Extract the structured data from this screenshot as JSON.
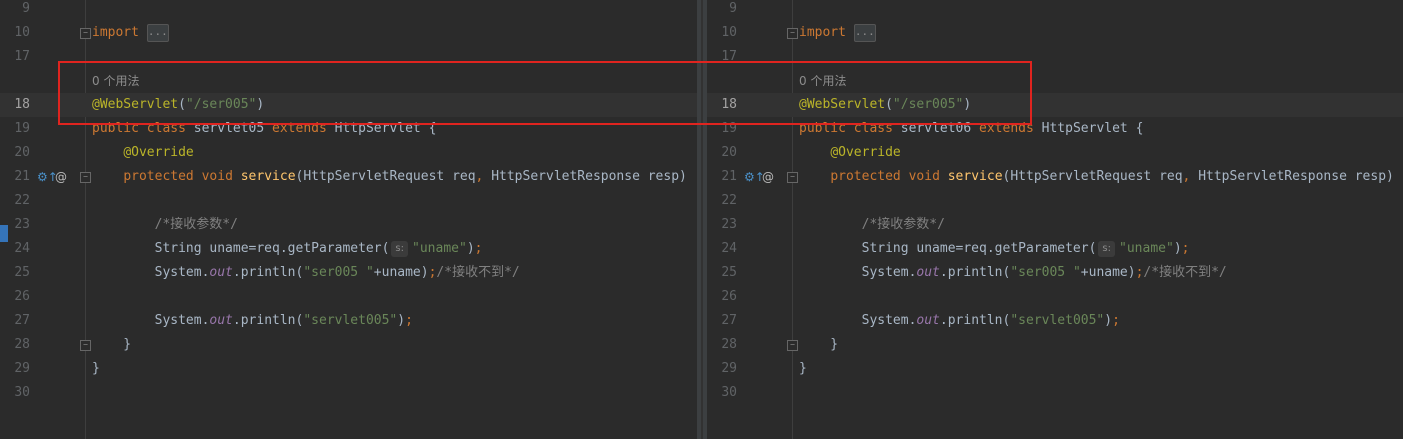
{
  "left_editor": {
    "lines": [
      {
        "num": "9",
        "tokens": []
      },
      {
        "num": "10",
        "fold": true,
        "tokens": [
          {
            "t": "import",
            "c": "kw"
          },
          {
            "t": " "
          },
          {
            "t": "...",
            "c": "foldbox"
          }
        ]
      },
      {
        "num": "17",
        "tokens": []
      },
      {
        "num": "",
        "tokens": [
          {
            "t": "0 个用法",
            "c": "hint"
          }
        ]
      },
      {
        "num": "18",
        "current": true,
        "tokens": [
          {
            "t": "@WebServlet",
            "c": "ann"
          },
          {
            "t": "("
          },
          {
            "t": "\"/ser005\"",
            "c": "str"
          },
          {
            "t": ")"
          }
        ]
      },
      {
        "num": "19",
        "tokens": [
          {
            "t": "public",
            "c": "kw"
          },
          {
            "t": " "
          },
          {
            "t": "class",
            "c": "kw"
          },
          {
            "t": " servlet05 "
          },
          {
            "t": "extends",
            "c": "kw"
          },
          {
            "t": " HttpServlet {"
          }
        ]
      },
      {
        "num": "20",
        "tokens": [
          {
            "t": "    "
          },
          {
            "t": "@Override",
            "c": "ann"
          }
        ]
      },
      {
        "num": "21",
        "gutter_icons": true,
        "tokens": [
          {
            "t": "    "
          },
          {
            "t": "protected",
            "c": "kw"
          },
          {
            "t": " "
          },
          {
            "t": "void",
            "c": "kw"
          },
          {
            "t": " "
          },
          {
            "t": "service",
            "c": "fn"
          },
          {
            "t": "(HttpServletRequest req"
          },
          {
            "t": ",",
            "c": "kw"
          },
          {
            "t": " HttpServletResponse resp)"
          }
        ]
      },
      {
        "num": "22",
        "tokens": []
      },
      {
        "num": "23",
        "tokens": [
          {
            "t": "        "
          },
          {
            "t": "/*接收参数*/",
            "c": "cm"
          }
        ]
      },
      {
        "num": "24",
        "tokens": [
          {
            "t": "        String uname=req.getParameter("
          },
          {
            "t": "s:",
            "c": "paramhint"
          },
          {
            "t": "\"uname\"",
            "c": "str"
          },
          {
            "t": ")"
          },
          {
            "t": ";",
            "c": "kw"
          }
        ]
      },
      {
        "num": "25",
        "tokens": [
          {
            "t": "        System."
          },
          {
            "t": "out",
            "c": "it"
          },
          {
            "t": ".println("
          },
          {
            "t": "\"ser005 \"",
            "c": "str"
          },
          {
            "t": "+uname)"
          },
          {
            "t": ";",
            "c": "kw"
          },
          {
            "t": "/*接收不到*/",
            "c": "cm"
          }
        ]
      },
      {
        "num": "26",
        "tokens": []
      },
      {
        "num": "27",
        "tokens": [
          {
            "t": "        System."
          },
          {
            "t": "out",
            "c": "it"
          },
          {
            "t": ".println("
          },
          {
            "t": "\"servlet005\"",
            "c": "str"
          },
          {
            "t": ")"
          },
          {
            "t": ";",
            "c": "kw"
          }
        ]
      },
      {
        "num": "28",
        "tokens": [
          {
            "t": "    }"
          }
        ]
      },
      {
        "num": "29",
        "tokens": [
          {
            "t": "}"
          }
        ]
      },
      {
        "num": "30",
        "tokens": []
      }
    ]
  },
  "right_editor": {
    "lines": [
      {
        "num": "9",
        "tokens": []
      },
      {
        "num": "10",
        "fold": true,
        "tokens": [
          {
            "t": "import",
            "c": "kw"
          },
          {
            "t": " "
          },
          {
            "t": "...",
            "c": "foldbox"
          }
        ]
      },
      {
        "num": "17",
        "tokens": []
      },
      {
        "num": "",
        "tokens": [
          {
            "t": "0 个用法",
            "c": "hint"
          }
        ]
      },
      {
        "num": "18",
        "current": true,
        "tokens": [
          {
            "t": "@WebServlet",
            "c": "ann"
          },
          {
            "t": "("
          },
          {
            "t": "\"/ser005\"",
            "c": "str"
          },
          {
            "t": ")"
          }
        ]
      },
      {
        "num": "19",
        "tokens": [
          {
            "t": "public",
            "c": "kw"
          },
          {
            "t": " "
          },
          {
            "t": "class",
            "c": "kw"
          },
          {
            "t": " servlet06 "
          },
          {
            "t": "extends",
            "c": "kw"
          },
          {
            "t": " HttpServlet {"
          }
        ]
      },
      {
        "num": "20",
        "tokens": [
          {
            "t": "    "
          },
          {
            "t": "@Override",
            "c": "ann"
          }
        ]
      },
      {
        "num": "21",
        "gutter_icons": true,
        "tokens": [
          {
            "t": "    "
          },
          {
            "t": "protected",
            "c": "kw"
          },
          {
            "t": " "
          },
          {
            "t": "void",
            "c": "kw"
          },
          {
            "t": " "
          },
          {
            "t": "service",
            "c": "fn"
          },
          {
            "t": "(HttpServletRequest req"
          },
          {
            "t": ",",
            "c": "kw"
          },
          {
            "t": " HttpServletResponse resp)"
          }
        ]
      },
      {
        "num": "22",
        "tokens": []
      },
      {
        "num": "23",
        "tokens": [
          {
            "t": "        "
          },
          {
            "t": "/*接收参数*/",
            "c": "cm"
          }
        ]
      },
      {
        "num": "24",
        "tokens": [
          {
            "t": "        String uname=req.getParameter("
          },
          {
            "t": "s:",
            "c": "paramhint"
          },
          {
            "t": "\"uname\"",
            "c": "str"
          },
          {
            "t": ")"
          },
          {
            "t": ";",
            "c": "kw"
          }
        ]
      },
      {
        "num": "25",
        "tokens": [
          {
            "t": "        System."
          },
          {
            "t": "out",
            "c": "it"
          },
          {
            "t": ".println("
          },
          {
            "t": "\"ser005 \"",
            "c": "str"
          },
          {
            "t": "+uname)"
          },
          {
            "t": ";",
            "c": "kw"
          },
          {
            "t": "/*接收不到*/",
            "c": "cm"
          }
        ]
      },
      {
        "num": "26",
        "tokens": []
      },
      {
        "num": "27",
        "tokens": [
          {
            "t": "        System."
          },
          {
            "t": "out",
            "c": "it"
          },
          {
            "t": ".println("
          },
          {
            "t": "\"servlet005\"",
            "c": "str"
          },
          {
            "t": ")"
          },
          {
            "t": ";",
            "c": "kw"
          }
        ]
      },
      {
        "num": "28",
        "tokens": [
          {
            "t": "    }"
          }
        ]
      },
      {
        "num": "29",
        "tokens": [
          {
            "t": "}"
          }
        ]
      },
      {
        "num": "30",
        "tokens": []
      }
    ]
  },
  "gutter": {
    "implements_icon": "implements-method-icon",
    "annotation_icon": "at-annotation-icon",
    "implements_glyph": "⚙↑",
    "annotation_glyph": "@"
  },
  "colors": {
    "background": "#2b2b2b",
    "keyword": "#cc7832",
    "annotation": "#bbb529",
    "string": "#6a8759",
    "method": "#ffc66d",
    "field": "#9876aa",
    "comment": "#808080",
    "highlight_box": "#e0241f"
  }
}
